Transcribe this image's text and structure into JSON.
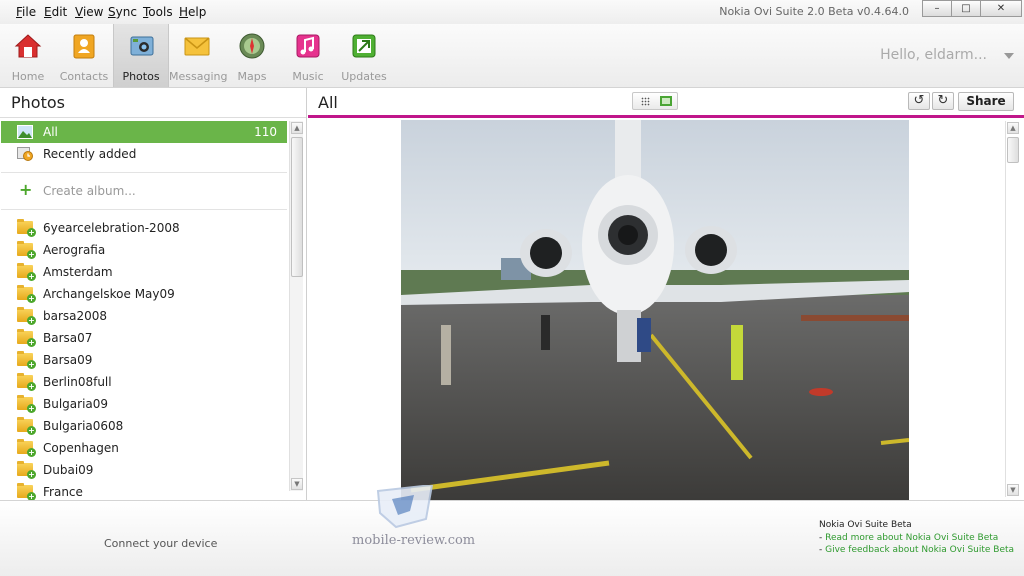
{
  "menu": {
    "items": [
      {
        "label": "File",
        "key": "F",
        "rest": "ile"
      },
      {
        "label": "Edit",
        "key": "E",
        "rest": "dit"
      },
      {
        "label": "View",
        "key": "V",
        "rest": "iew"
      },
      {
        "label": "Sync",
        "key": "S",
        "rest": "ync"
      },
      {
        "label": "Tools",
        "key": "T",
        "rest": "ools"
      },
      {
        "label": "Help",
        "key": "H",
        "rest": "elp"
      }
    ]
  },
  "window": {
    "title": "Nokia Ovi Suite 2.0 Beta v0.4.64.0",
    "minimize": "–",
    "maximize": "□",
    "close": "✕"
  },
  "toolbar": {
    "items": [
      {
        "label": "Home",
        "icon": "home-icon"
      },
      {
        "label": "Contacts",
        "icon": "contacts-icon"
      },
      {
        "label": "Photos",
        "icon": "photos-icon",
        "active": true
      },
      {
        "label": "Messaging",
        "icon": "messaging-icon"
      },
      {
        "label": "Maps",
        "icon": "maps-icon"
      },
      {
        "label": "Music",
        "icon": "music-icon"
      },
      {
        "label": "Updates",
        "icon": "updates-icon"
      }
    ],
    "greeting": "Hello, eldarm..."
  },
  "left": {
    "title": "Photos",
    "all_label": "All",
    "all_count": "110",
    "recent_label": "Recently added",
    "create_label": "Create album...",
    "albums": [
      "6yearcelebration-2008",
      "Aerografia",
      "Amsterdam",
      "Archangelskoe May09",
      "barsa2008",
      "Barsa07",
      "Barsa09",
      "Berlin08full",
      "Bulgaria09",
      "Bulgaria0608",
      "Copenhagen",
      "Dubai09",
      "France"
    ]
  },
  "right": {
    "title": "All",
    "rotate_left": "↺",
    "rotate_right": "↻",
    "share_label": "Share"
  },
  "footer": {
    "connect": "Connect your device",
    "watermark": "mobile-review.com",
    "beta_title": "Nokia Ovi Suite Beta",
    "link_prefix": "- ",
    "read_more": "Read more about Nokia Ovi Suite Beta",
    "feedback": "Give feedback about Nokia Ovi Suite Beta"
  },
  "colors": {
    "accent_green": "#6ab549",
    "accent_magenta": "#c0168a"
  }
}
